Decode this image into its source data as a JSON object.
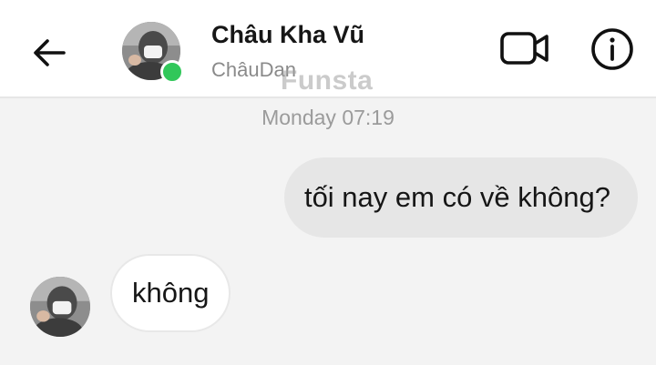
{
  "header": {
    "contact_name": "Châu Kha Vũ",
    "contact_username": "ChâuDan",
    "online": true,
    "icons": {
      "back": "back-arrow-icon",
      "video": "video-call-icon",
      "info": "info-icon"
    }
  },
  "watermark": "Funsta",
  "conversation": {
    "timestamp": "Monday 07:19",
    "messages": [
      {
        "direction": "sent",
        "text": "tối nay em có về không?"
      },
      {
        "direction": "received",
        "text": "không"
      }
    ]
  },
  "colors": {
    "online_status": "#31c75a",
    "sent_bubble": "#e6e6e6",
    "received_bubble": "#ffffff",
    "background": "#f3f3f3"
  }
}
